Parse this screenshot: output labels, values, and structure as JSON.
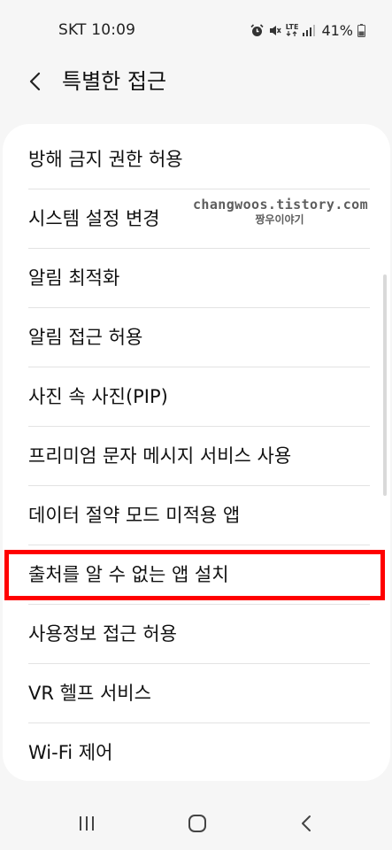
{
  "status_bar": {
    "carrier_time": "SKT 10:09",
    "network": "LTE",
    "battery": "41%",
    "icons": [
      "alarm-icon",
      "mute-icon",
      "lte-icon",
      "signal-icon",
      "battery-icon"
    ]
  },
  "header": {
    "back_icon": "chevron-left-icon",
    "title": "특별한 접근"
  },
  "settings": {
    "items": [
      {
        "label": "방해 금지 권한 허용"
      },
      {
        "label": "시스템 설정 변경"
      },
      {
        "label": "알림 최적화"
      },
      {
        "label": "알림 접근 허용"
      },
      {
        "label": "사진 속 사진(PIP)"
      },
      {
        "label": "프리미엄 문자 메시지 서비스 사용"
      },
      {
        "label": "데이터 절약 모드 미적용 앱"
      },
      {
        "label": "출처를 알 수 없는 앱 설치"
      },
      {
        "label": "사용정보 접근 허용"
      },
      {
        "label": "VR 헬프 서비스"
      },
      {
        "label": "Wi-Fi 제어"
      }
    ],
    "highlighted_item": "출처를 알 수 없는 앱 설치"
  },
  "watermark": {
    "line1": "changwoos.tistory.com",
    "line2": "짱우이야기"
  },
  "nav_bar": {
    "icons": [
      "recent-apps-icon",
      "home-icon",
      "back-icon"
    ]
  },
  "colors": {
    "background": "#f6f6f6",
    "card": "#ffffff",
    "highlight": "#ff0000",
    "text": "#111111"
  }
}
